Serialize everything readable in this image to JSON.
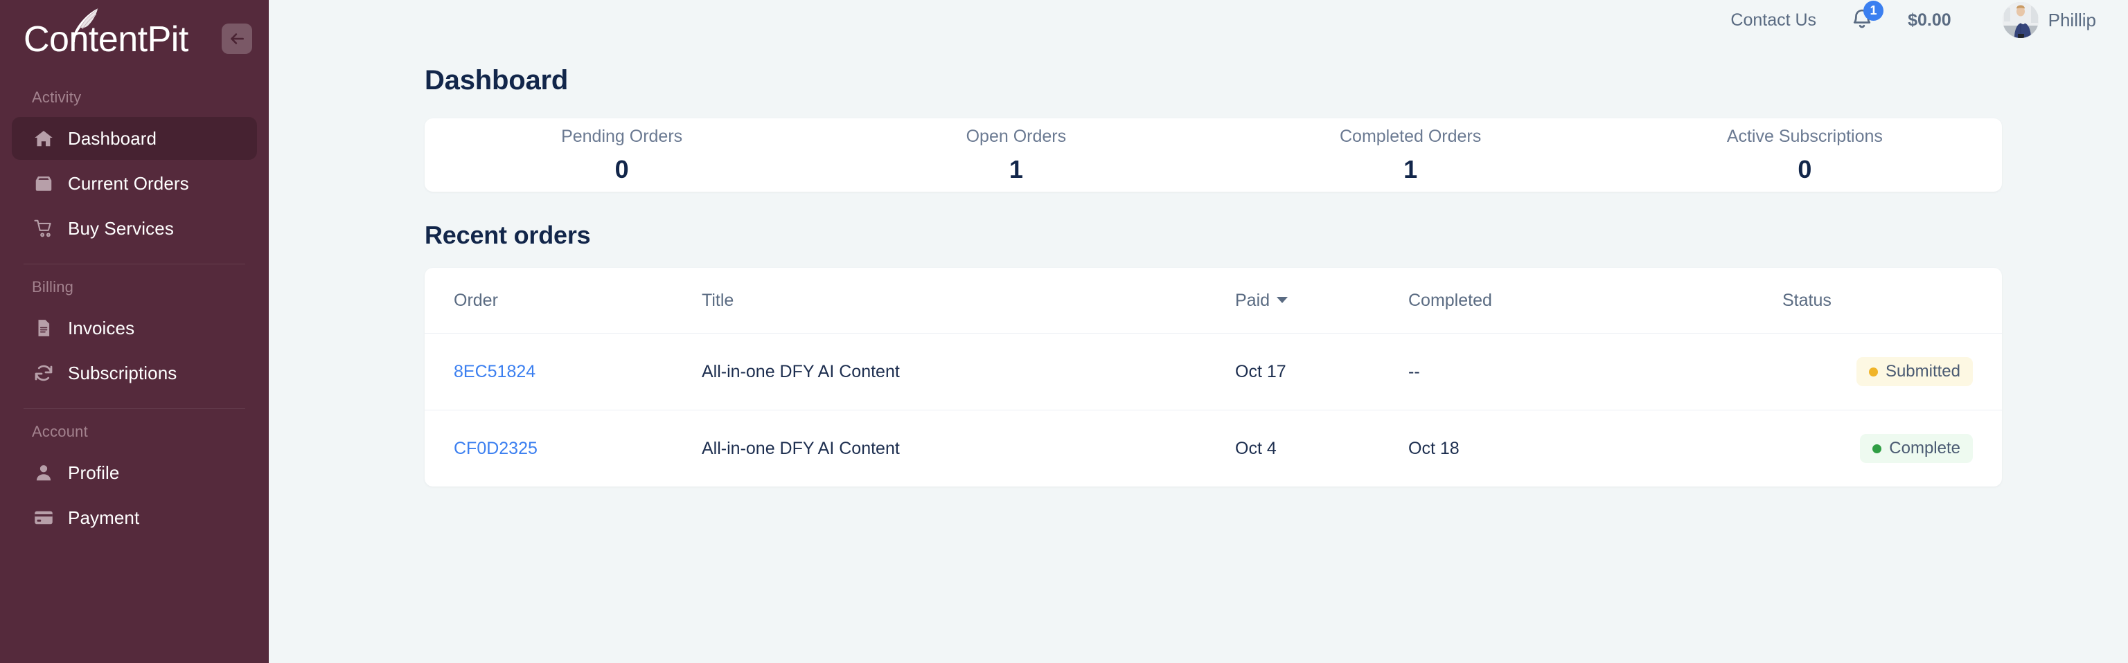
{
  "brand": {
    "name": "ContentPit",
    "sidebar_bg": "#552a3c",
    "accent_blue": "#3b7ff0"
  },
  "sidebar": {
    "collapse_label": "←",
    "sections": [
      {
        "label": "Activity",
        "items": [
          {
            "label": "Dashboard",
            "icon": "home-icon",
            "active": true
          },
          {
            "label": "Current Orders",
            "icon": "inbox-icon",
            "active": false
          },
          {
            "label": "Buy Services",
            "icon": "cart-icon",
            "active": false
          }
        ]
      },
      {
        "label": "Billing",
        "items": [
          {
            "label": "Invoices",
            "icon": "document-icon",
            "active": false
          },
          {
            "label": "Subscriptions",
            "icon": "refresh-icon",
            "active": false
          }
        ]
      },
      {
        "label": "Account",
        "items": [
          {
            "label": "Profile",
            "icon": "user-icon",
            "active": false
          },
          {
            "label": "Payment",
            "icon": "credit-card-icon",
            "active": false
          }
        ]
      }
    ]
  },
  "topbar": {
    "contact_label": "Contact Us",
    "notification_count": "1",
    "balance": "$0.00",
    "username": "Phillip"
  },
  "page": {
    "title": "Dashboard",
    "recent_orders_title": "Recent orders"
  },
  "stats": [
    {
      "label": "Pending Orders",
      "value": "0"
    },
    {
      "label": "Open Orders",
      "value": "1"
    },
    {
      "label": "Completed Orders",
      "value": "1"
    },
    {
      "label": "Active Subscriptions",
      "value": "0"
    }
  ],
  "orders_table": {
    "columns": {
      "order": "Order",
      "title": "Title",
      "paid": "Paid",
      "completed": "Completed",
      "status": "Status"
    },
    "sorted_by": "paid",
    "rows": [
      {
        "order": "8EC51824",
        "title": "All-in-one DFY AI Content",
        "paid": "Oct 17",
        "completed": "--",
        "status": "Submitted",
        "status_kind": "submitted"
      },
      {
        "order": "CF0D2325",
        "title": "All-in-one DFY AI Content",
        "paid": "Oct 4",
        "completed": "Oct 18",
        "status": "Complete",
        "status_kind": "complete"
      }
    ]
  }
}
